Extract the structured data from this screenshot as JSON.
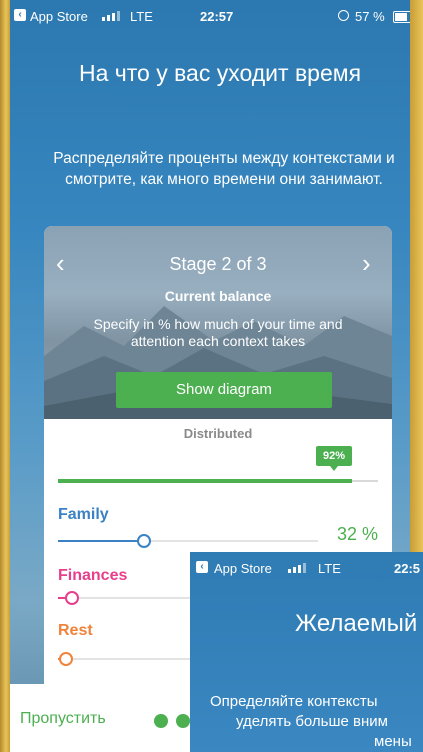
{
  "status": {
    "app": "App Store",
    "network": "LTE",
    "time": "22:57",
    "battery": "57 %"
  },
  "header": {
    "title": "На что у вас уходит время",
    "subtitle": "Распределяйте проценты между контекстами и смотрите, как много времени они занимают."
  },
  "card": {
    "stage": "Stage 2 of 3",
    "heading": "Current balance",
    "description": "Specify in % how much of your time and attention each context takes",
    "button_label": "Show diagram",
    "distributed": {
      "label": "Distributed",
      "value": 92,
      "badge": "92%",
      "color": "#4caf50"
    },
    "contexts": [
      {
        "name": "Family",
        "percent": 32,
        "percent_label": "32 %",
        "color": "#3b82c4"
      },
      {
        "name": "Finances",
        "percent": 5,
        "percent_label": "",
        "color": "#e83e8c"
      },
      {
        "name": "Rest",
        "percent": 3,
        "percent_label": "",
        "color": "#f0833a"
      }
    ]
  },
  "footer": {
    "skip_label": "Пропустить",
    "accent": "#4caf50"
  },
  "overlay": {
    "status": {
      "app": "App Store",
      "network": "LTE",
      "time": "22:5"
    },
    "title": "Желаемый",
    "line1": "Определяйте контексты",
    "line2": "уделять больше вним",
    "line3": "мены"
  }
}
